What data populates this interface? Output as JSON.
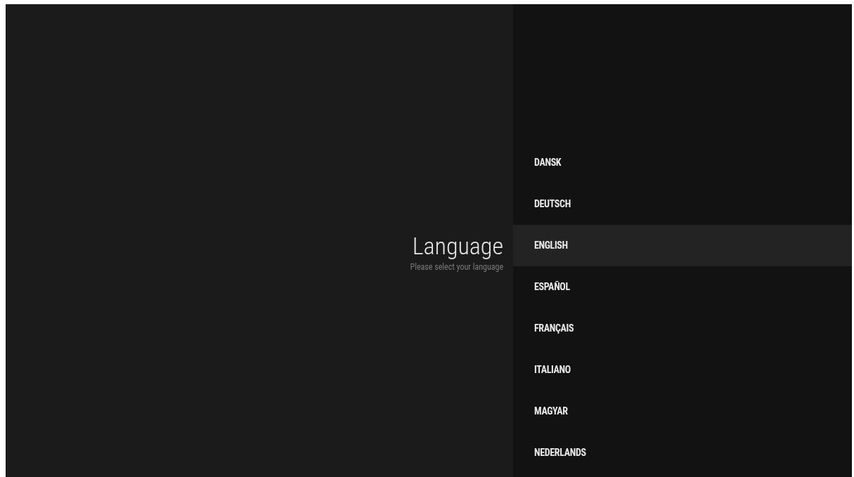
{
  "header": {
    "title": "Language",
    "subtitle": "Please select your language"
  },
  "languages": [
    {
      "label": "DANSK",
      "selected": false
    },
    {
      "label": "DEUTSCH",
      "selected": false
    },
    {
      "label": "ENGLISH",
      "selected": true
    },
    {
      "label": "ESPAÑOL",
      "selected": false
    },
    {
      "label": "FRANÇAIS",
      "selected": false
    },
    {
      "label": "ITALIANO",
      "selected": false
    },
    {
      "label": "MAGYAR",
      "selected": false
    },
    {
      "label": "NEDERLANDS",
      "selected": false
    }
  ]
}
